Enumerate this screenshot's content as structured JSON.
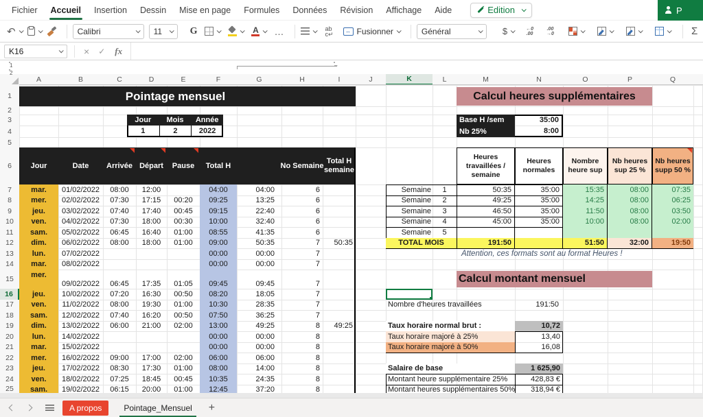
{
  "ribbon": {
    "tabs": [
      "Fichier",
      "Accueil",
      "Insertion",
      "Dessin",
      "Mise en page",
      "Formules",
      "Données",
      "Révision",
      "Affichage",
      "Aide"
    ],
    "active_tab": "Accueil",
    "edition_label": "Edition",
    "share_label": "P"
  },
  "toolbar": {
    "font_name": "Calibri",
    "font_size": "11",
    "bold_label": "G",
    "merge_label": "Fusionner",
    "number_format": "Général",
    "dollar": "$",
    "ellipsis": "…",
    "sigma": "Σ"
  },
  "formula_bar": {
    "name_box": "K16"
  },
  "grid": {
    "col_letters": [
      "A",
      "B",
      "C",
      "D",
      "E",
      "F",
      "G",
      "H",
      "I",
      "J",
      "K",
      "L",
      "M",
      "N",
      "O",
      "P",
      "Q"
    ],
    "row_numbers": [
      1,
      2,
      3,
      4,
      5,
      6,
      7,
      8,
      9,
      10,
      11,
      12,
      13,
      14,
      15,
      16,
      17,
      18,
      19,
      20,
      21,
      22,
      23,
      24,
      25
    ],
    "selected_col": "K",
    "selected_row": 16,
    "outline_buttons": [
      "1",
      "2"
    ],
    "collapse_label": "–"
  },
  "sheet": {
    "title_banner": "Pointage mensuel",
    "date_box": {
      "headers": [
        "Jour",
        "Mois",
        "Année"
      ],
      "values": [
        "1",
        "2",
        "2022"
      ]
    },
    "timesheet": {
      "headers": [
        "Jour",
        "Date",
        "Arrivée",
        "Départ",
        "Pause",
        "Total H",
        "",
        "No Semaine",
        "Total H semaine"
      ],
      "rows": [
        {
          "jour": "mar.",
          "date": "01/02/2022",
          "arr": "08:00",
          "dep": "12:00",
          "pause": "",
          "th": "04:00",
          "cum": "04:00",
          "sem": "6",
          "tsem": ""
        },
        {
          "jour": "mer.",
          "date": "02/02/2022",
          "arr": "07:30",
          "dep": "17:15",
          "pause": "00:20",
          "th": "09:25",
          "cum": "13:25",
          "sem": "6",
          "tsem": ""
        },
        {
          "jour": "jeu.",
          "date": "03/02/2022",
          "arr": "07:40",
          "dep": "17:40",
          "pause": "00:45",
          "th": "09:15",
          "cum": "22:40",
          "sem": "6",
          "tsem": ""
        },
        {
          "jour": "ven.",
          "date": "04/02/2022",
          "arr": "07:30",
          "dep": "18:00",
          "pause": "00:30",
          "th": "10:00",
          "cum": "32:40",
          "sem": "6",
          "tsem": ""
        },
        {
          "jour": "sam.",
          "date": "05/02/2022",
          "arr": "06:45",
          "dep": "16:40",
          "pause": "01:00",
          "th": "08:55",
          "cum": "41:35",
          "sem": "6",
          "tsem": ""
        },
        {
          "jour": "dim.",
          "date": "06/02/2022",
          "arr": "08:00",
          "dep": "18:00",
          "pause": "01:00",
          "th": "09:00",
          "cum": "50:35",
          "sem": "7",
          "tsem": "50:35"
        },
        {
          "jour": "lun.",
          "date": "07/02/2022",
          "arr": "",
          "dep": "",
          "pause": "",
          "th": "00:00",
          "cum": "00:00",
          "sem": "7",
          "tsem": ""
        },
        {
          "jour": "mar.",
          "date": "08/02/2022",
          "arr": "",
          "dep": "",
          "pause": "",
          "th": "00:00",
          "cum": "00:00",
          "sem": "7",
          "tsem": ""
        },
        {
          "jour": "mer.",
          "date": "09/02/2022",
          "arr": "06:45",
          "dep": "17:35",
          "pause": "01:05",
          "th": "09:45",
          "cum": "09:45",
          "sem": "7",
          "tsem": ""
        },
        {
          "jour": "jeu.",
          "date": "10/02/2022",
          "arr": "07:20",
          "dep": "16:30",
          "pause": "00:50",
          "th": "08:20",
          "cum": "18:05",
          "sem": "7",
          "tsem": ""
        },
        {
          "jour": "ven.",
          "date": "11/02/2022",
          "arr": "08:00",
          "dep": "19:30",
          "pause": "01:00",
          "th": "10:30",
          "cum": "28:35",
          "sem": "7",
          "tsem": ""
        },
        {
          "jour": "sam.",
          "date": "12/02/2022",
          "arr": "07:40",
          "dep": "16:20",
          "pause": "00:50",
          "th": "07:50",
          "cum": "36:25",
          "sem": "7",
          "tsem": ""
        },
        {
          "jour": "dim.",
          "date": "13/02/2022",
          "arr": "06:00",
          "dep": "21:00",
          "pause": "02:00",
          "th": "13:00",
          "cum": "49:25",
          "sem": "8",
          "tsem": "49:25"
        },
        {
          "jour": "lun.",
          "date": "14/02/2022",
          "arr": "",
          "dep": "",
          "pause": "",
          "th": "00:00",
          "cum": "00:00",
          "sem": "8",
          "tsem": ""
        },
        {
          "jour": "mar.",
          "date": "15/02/2022",
          "arr": "",
          "dep": "",
          "pause": "",
          "th": "00:00",
          "cum": "00:00",
          "sem": "8",
          "tsem": ""
        },
        {
          "jour": "mer.",
          "date": "16/02/2022",
          "arr": "09:00",
          "dep": "17:00",
          "pause": "02:00",
          "th": "06:00",
          "cum": "06:00",
          "sem": "8",
          "tsem": ""
        },
        {
          "jour": "jeu.",
          "date": "17/02/2022",
          "arr": "08:30",
          "dep": "17:30",
          "pause": "01:00",
          "th": "08:00",
          "cum": "14:00",
          "sem": "8",
          "tsem": ""
        },
        {
          "jour": "ven.",
          "date": "18/02/2022",
          "arr": "07:25",
          "dep": "18:45",
          "pause": "00:45",
          "th": "10:35",
          "cum": "24:35",
          "sem": "8",
          "tsem": ""
        },
        {
          "jour": "sam.",
          "date": "19/02/2022",
          "arr": "06:15",
          "dep": "20:00",
          "pause": "01:00",
          "th": "12:45",
          "cum": "37:20",
          "sem": "8",
          "tsem": ""
        }
      ]
    },
    "overtime": {
      "title": "Calcul heures supplémentaires",
      "base_label": "Base H /sem",
      "base_value": "35:00",
      "nb_label": "Nb 25%",
      "nb_value": "8:00",
      "week_headers": [
        "Heures travaillées / semaine",
        "Heures normales",
        "Nombre heure sup",
        "Nb heures sup 25 %",
        "Nb heures supp 50 %"
      ],
      "week_label": "Semaine",
      "weeks": [
        {
          "num": "1",
          "worked": "50:35",
          "normal": "35:00",
          "sup": "15:35",
          "sup25": "08:00",
          "sup50": "07:35"
        },
        {
          "num": "2",
          "worked": "49:25",
          "normal": "35:00",
          "sup": "14:25",
          "sup25": "08:00",
          "sup50": "06:25"
        },
        {
          "num": "3",
          "worked": "46:50",
          "normal": "35:00",
          "sup": "11:50",
          "sup25": "08:00",
          "sup50": "03:50"
        },
        {
          "num": "4",
          "worked": "45:00",
          "normal": "35:00",
          "sup": "10:00",
          "sup25": "08:00",
          "sup50": "02:00"
        },
        {
          "num": "5",
          "worked": "",
          "normal": "",
          "sup": "",
          "sup25": "",
          "sup50": ""
        }
      ],
      "total_label": "TOTAL MOIS",
      "total_worked": "191:50",
      "total_sup": "51:50",
      "total_sup25": "32:00",
      "total_sup50": "19:50",
      "note": "Attention, ces formats sont au format Heures !"
    },
    "monthly": {
      "title": "Calcul montant mensuel",
      "hours_label": "Nombre d'heures travaillées",
      "hours_value": "191:50",
      "rate_label": "Taux horaire normal brut :",
      "rate_value": "10,72",
      "rate25_label": "Taux horaire majoré à 25%",
      "rate25_value": "13,40",
      "rate50_label": "Taux horaire majoré à 50%",
      "rate50_value": "16,08",
      "salary_label": "Salaire de base",
      "salary_value": "1 625,90",
      "amt25_label": "Montant heure supplémentaire 25%",
      "amt25_value": "428,83 €",
      "amt50_label": "Montant heures supplémentaires 50%",
      "amt50_value": "318,94 €"
    }
  },
  "tab_bar": {
    "tabs": [
      {
        "label": "A propos"
      },
      {
        "label": "Pointage_Mensuel"
      }
    ]
  },
  "colors": {
    "accent_green": "#107C41",
    "banner_black": "#1f1f1f",
    "col_a_yellow": "#edbb33",
    "col_f_blue": "#b7c5e4",
    "pink_title": "#c78b8f",
    "green_cell_bg": "#c6efce",
    "green_cell_text": "#277c47",
    "total_yellow": "#fbf65e",
    "peach_light": "#fbe5d6",
    "peach_dark": "#f2b183",
    "gray_value": "#bfbfbf",
    "red_tab": "#e8452f",
    "note_blue": "#44546a",
    "dark_red_text": "#843c0c"
  }
}
